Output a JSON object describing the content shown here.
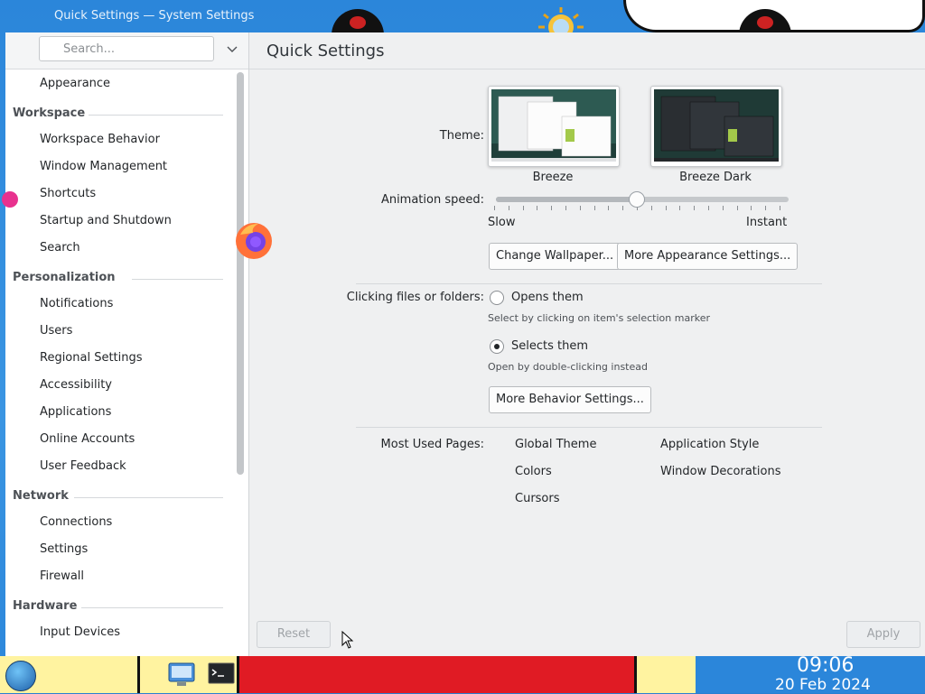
{
  "window": {
    "title": "Quick Settings — System Settings"
  },
  "sidebar": {
    "search_placeholder": "Search...",
    "items": [
      {
        "type": "item",
        "label": "Appearance"
      },
      {
        "type": "category",
        "label": "Workspace"
      },
      {
        "type": "item",
        "label": "Workspace Behavior"
      },
      {
        "type": "item",
        "label": "Window Management"
      },
      {
        "type": "item",
        "label": "Shortcuts"
      },
      {
        "type": "item",
        "label": "Startup and Shutdown"
      },
      {
        "type": "item",
        "label": "Search"
      },
      {
        "type": "category",
        "label": "Personalization"
      },
      {
        "type": "item",
        "label": "Notifications"
      },
      {
        "type": "item",
        "label": "Users"
      },
      {
        "type": "item",
        "label": "Regional Settings"
      },
      {
        "type": "item",
        "label": "Accessibility"
      },
      {
        "type": "item",
        "label": "Applications"
      },
      {
        "type": "item",
        "label": "Online Accounts"
      },
      {
        "type": "item",
        "label": "User Feedback"
      },
      {
        "type": "category",
        "label": "Network"
      },
      {
        "type": "item",
        "label": "Connections"
      },
      {
        "type": "item",
        "label": "Settings"
      },
      {
        "type": "item",
        "label": "Firewall"
      },
      {
        "type": "category",
        "label": "Hardware"
      },
      {
        "type": "item",
        "label": "Input Devices"
      }
    ]
  },
  "main": {
    "title": "Quick Settings",
    "theme": {
      "label": "Theme:",
      "options": [
        {
          "name": "Breeze",
          "style": "light"
        },
        {
          "name": "Breeze Dark",
          "style": "dark"
        }
      ]
    },
    "animation": {
      "label": "Animation speed:",
      "min_label": "Slow",
      "max_label": "Instant",
      "value_fraction": 0.5
    },
    "buttons": {
      "change_wallpaper": "Change Wallpaper...",
      "more_appearance": "More Appearance Settings...",
      "more_behavior": "More Behavior Settings..."
    },
    "clicking": {
      "label": "Clicking files or folders:",
      "options": [
        {
          "label": "Opens them",
          "hint": "Select by clicking on item's selection marker",
          "selected": false
        },
        {
          "label": "Selects them",
          "hint": "Open by double-clicking instead",
          "selected": true
        }
      ]
    },
    "most_used": {
      "label": "Most Used Pages:",
      "pages": [
        "Global Theme",
        "Application Style",
        "Colors",
        "Window Decorations",
        "Cursors"
      ]
    }
  },
  "footer": {
    "reset": "Reset",
    "apply": "Apply"
  },
  "taskbar": {
    "time": "09:06",
    "date": "20 Feb 2024"
  }
}
